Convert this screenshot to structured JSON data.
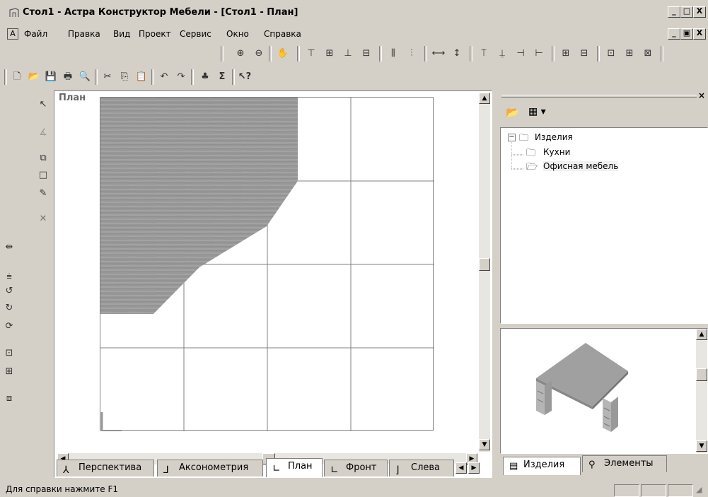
{
  "window": {
    "title": "Стол1 - Астра Конструктор Мебели - [Стол1 - План]",
    "controls": [
      "_",
      "□",
      "X"
    ],
    "doc_controls": [
      "_",
      "▣",
      "X"
    ]
  },
  "menu": {
    "items": [
      "Файл",
      "Правка",
      "Вид",
      "Проект",
      "Сервис",
      "Окно",
      "Справка"
    ]
  },
  "toolbar_top": {
    "icons": [
      "zoom-in-icon",
      "zoom-out-icon",
      "pan-hand-icon",
      "align-icon",
      "align-icon",
      "align-icon",
      "align-icon",
      "distribute-icon",
      "distribute-icon",
      "size-icon",
      "size-icon",
      "snap-icon",
      "snap-icon",
      "snap-icon",
      "snap-icon",
      "layout-icon",
      "layout-icon",
      "layout-icon",
      "layout-icon",
      "layout-icon"
    ]
  },
  "toolbar_std": {
    "icons": [
      "new-icon",
      "open-icon",
      "save-icon",
      "print-icon",
      "preview-icon",
      "cut-icon",
      "copy-icon",
      "paste-icon",
      "undo-icon",
      "redo-icon",
      "structure-icon",
      "sum-icon",
      "help-pointer-icon"
    ]
  },
  "plan": {
    "label": "План"
  },
  "view_tabs": [
    "Перспектива",
    "Аксонометрия",
    "План",
    "Фронт",
    "Слева"
  ],
  "active_view_tab": "План",
  "panel": {
    "tree": {
      "root": "Изделия",
      "children": [
        "Кухни",
        "Офисная мебель"
      ]
    },
    "bottom_tabs": [
      "Изделия",
      "Элементы"
    ]
  },
  "status": {
    "text": "Для справки нажмите F1"
  }
}
